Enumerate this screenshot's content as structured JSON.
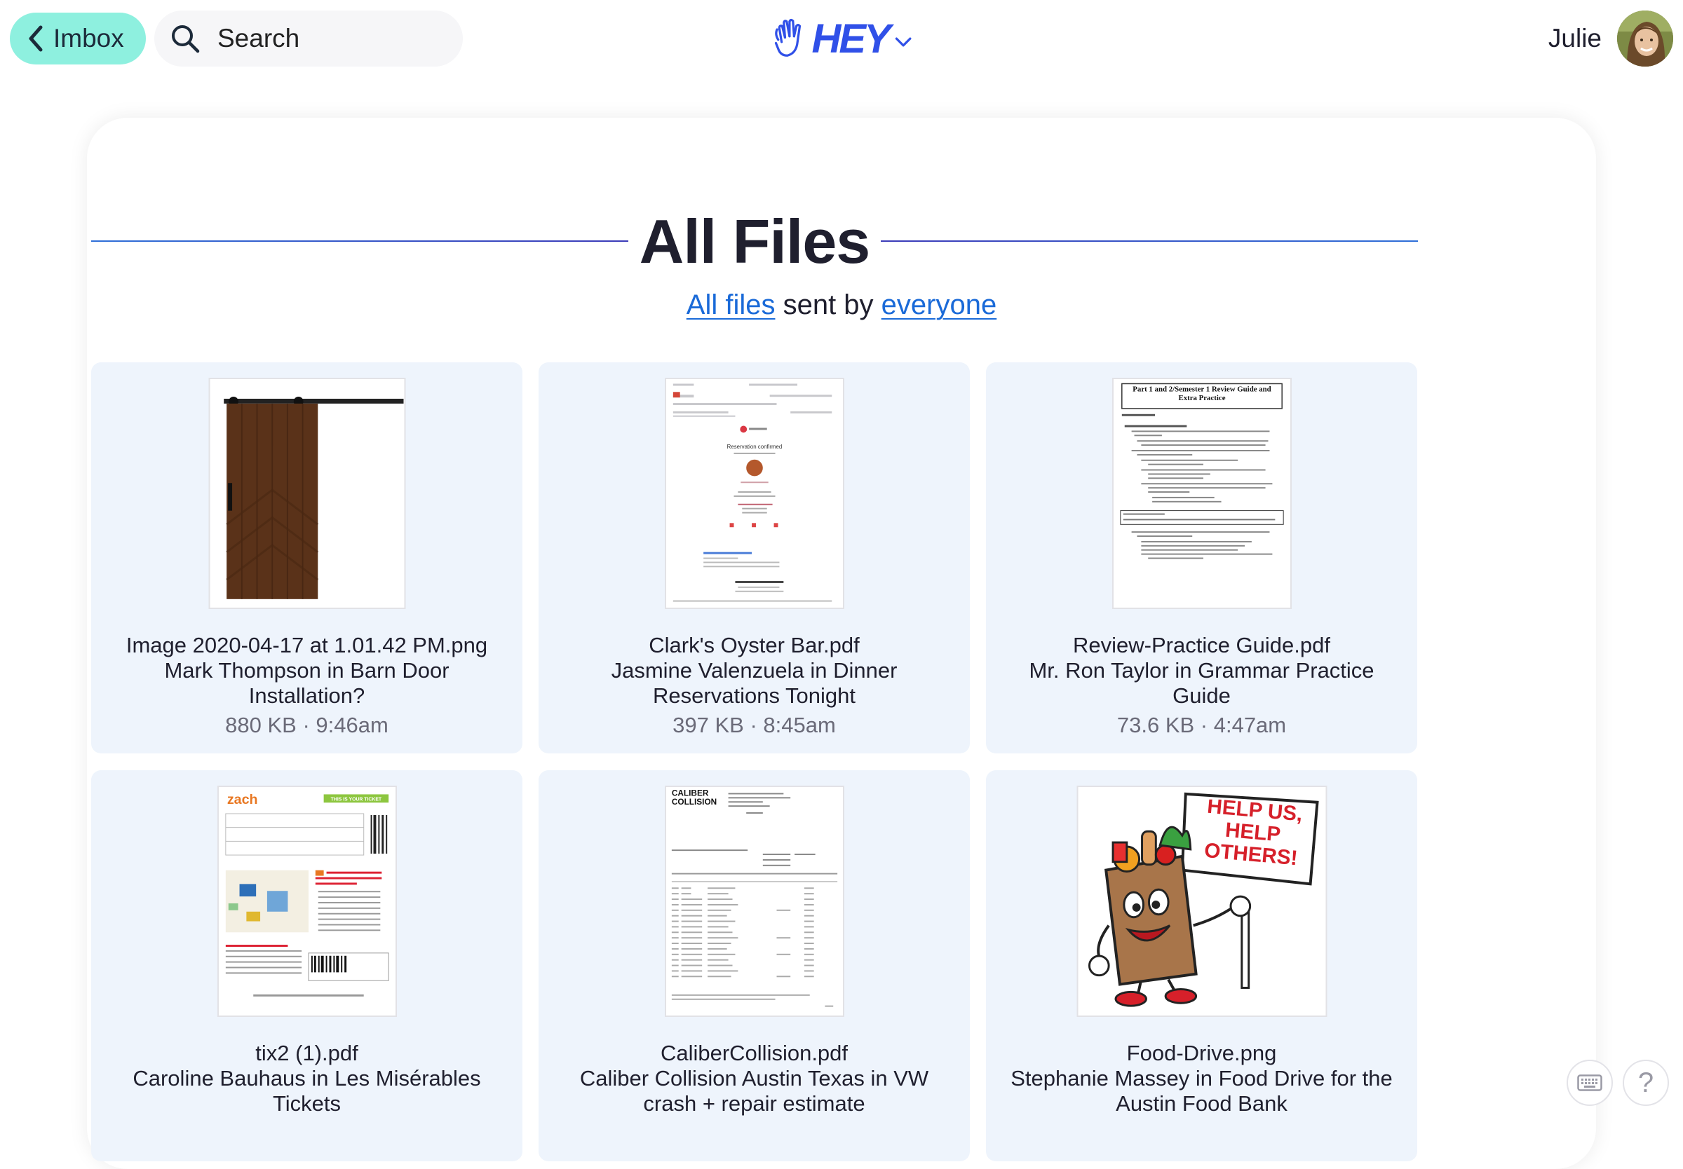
{
  "topbar": {
    "back_label": "Imbox",
    "search_placeholder": "Search",
    "logo_text": "HEY",
    "user_name": "Julie"
  },
  "main": {
    "title": "All Files",
    "subtitle": {
      "link1": "All files",
      "middle": " sent by ",
      "link2": "everyone"
    }
  },
  "files": [
    {
      "name": "Image 2020-04-17 at 1.01.42 PM.png",
      "thread": "Mark Thompson in Barn Door Installation?",
      "meta": "880 KB · 9:46am",
      "thumb": "barn-door-image"
    },
    {
      "name": "Clark's Oyster Bar.pdf",
      "thread": "Jasmine Valenzuela in Dinner Reservations Tonight",
      "meta": "397 KB · 8:45am",
      "thumb": "reservation-email-pdf"
    },
    {
      "name": "Review-Practice Guide.pdf",
      "thread": "Mr. Ron Taylor in Grammar Practice Guide",
      "meta": "73.6 KB · 4:47am",
      "thumb": "review-guide-pdf"
    },
    {
      "name": "tix2 (1).pdf",
      "thread": "Caroline Bauhaus in Les Misérables Tickets",
      "meta": "",
      "thumb": "ticket-pdf"
    },
    {
      "name": "CaliberCollision.pdf",
      "thread": "Caliber Collision Austin Texas in VW crash + repair estimate",
      "meta": "",
      "thumb": "estimate-pdf"
    },
    {
      "name": "Food-Drive.png",
      "thread": "Stephanie Massey in Food Drive for the Austin Food Bank",
      "meta": "",
      "thumb": "food-drive-image"
    }
  ],
  "thumb_text": {
    "reservation_heading": "Reservation confirmed",
    "guide_title": "Part 1 and 2/Semester 1 Review Guide and Extra Practice",
    "ticket_brand": "zach",
    "ticket_banner": "THIS IS YOUR TICKET",
    "estimate_brand": "CALIBER COLLISION",
    "poster_text": "HELP US, HELP OTHERS!"
  },
  "help_glyph": "?",
  "colors": {
    "imbox_bg": "#8ef0df",
    "accent": "#3050e8",
    "link": "#1a6ad8",
    "card_bg": "#eef4fc"
  }
}
